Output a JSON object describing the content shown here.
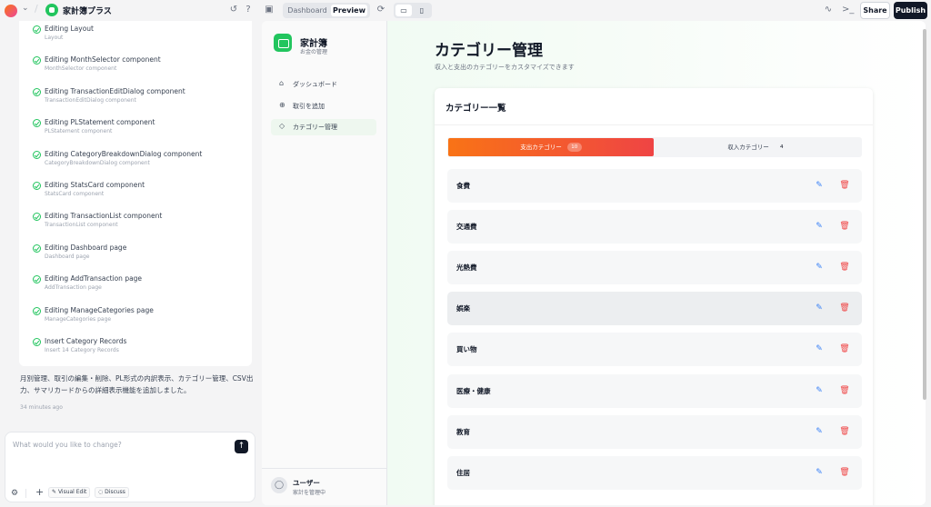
{
  "topbar": {
    "app_name": "家計簿プラス",
    "view_tabs": [
      "Dashboard",
      "Preview"
    ],
    "share_label": "Share",
    "publish_label": "Publish"
  },
  "chat": {
    "steps": [
      {
        "title": "Editing Layout",
        "sub": "Layout"
      },
      {
        "title": "Editing MonthSelector component",
        "sub": "MonthSelector component"
      },
      {
        "title": "Editing TransactionEditDialog component",
        "sub": "TransactionEditDialog component"
      },
      {
        "title": "Editing PLStatement component",
        "sub": "PLStatement component"
      },
      {
        "title": "Editing CategoryBreakdownDialog component",
        "sub": "CategoryBreakdownDialog component"
      },
      {
        "title": "Editing StatsCard component",
        "sub": "StatsCard component"
      },
      {
        "title": "Editing TransactionList component",
        "sub": "TransactionList component"
      },
      {
        "title": "Editing Dashboard page",
        "sub": "Dashboard page"
      },
      {
        "title": "Editing AddTransaction page",
        "sub": "AddTransaction page"
      },
      {
        "title": "Editing ManageCategories page",
        "sub": "ManageCategories page"
      },
      {
        "title": "Insert Category Records",
        "sub": "Insert 14 Category Records"
      }
    ],
    "message": "月別管理、取引の編集・削除、PL形式の内訳表示、カテゴリー管理、CSV出力、サマリカードからの詳細表示機能を追加しました。",
    "time": "34 minutes ago",
    "composer_placeholder": "What would you like to change?",
    "visual_edit_label": "Visual Edit",
    "discuss_label": "Discuss"
  },
  "app": {
    "brand_name": "家計簿",
    "brand_sub": "お金の管理",
    "nav": [
      {
        "label": "ダッシュボード",
        "icon": "home-icon"
      },
      {
        "label": "取引を追加",
        "icon": "plus-circle-icon"
      },
      {
        "label": "カテゴリー管理",
        "icon": "tag-icon"
      }
    ],
    "user_name": "ユーザー",
    "user_sub": "家計を管理中"
  },
  "page": {
    "title": "カテゴリー管理",
    "subtitle": "収入と支出のカテゴリーをカスタマイズできます",
    "card_title": "カテゴリー一覧",
    "tab_expense_label": "支出カテゴリー",
    "tab_expense_count": "10",
    "tab_income_label": "収入カテゴリー",
    "tab_income_count": "4",
    "categories": [
      "食費",
      "交通費",
      "光熱費",
      "娯楽",
      "買い物",
      "医療・健康",
      "教育",
      "住居"
    ]
  },
  "colors": {
    "accent_green": "#22c55e",
    "tab_gradient_start": "#f97316",
    "tab_gradient_end": "#ef4444",
    "edit_blue": "#3b82f6",
    "delete_red": "#ef4444"
  }
}
